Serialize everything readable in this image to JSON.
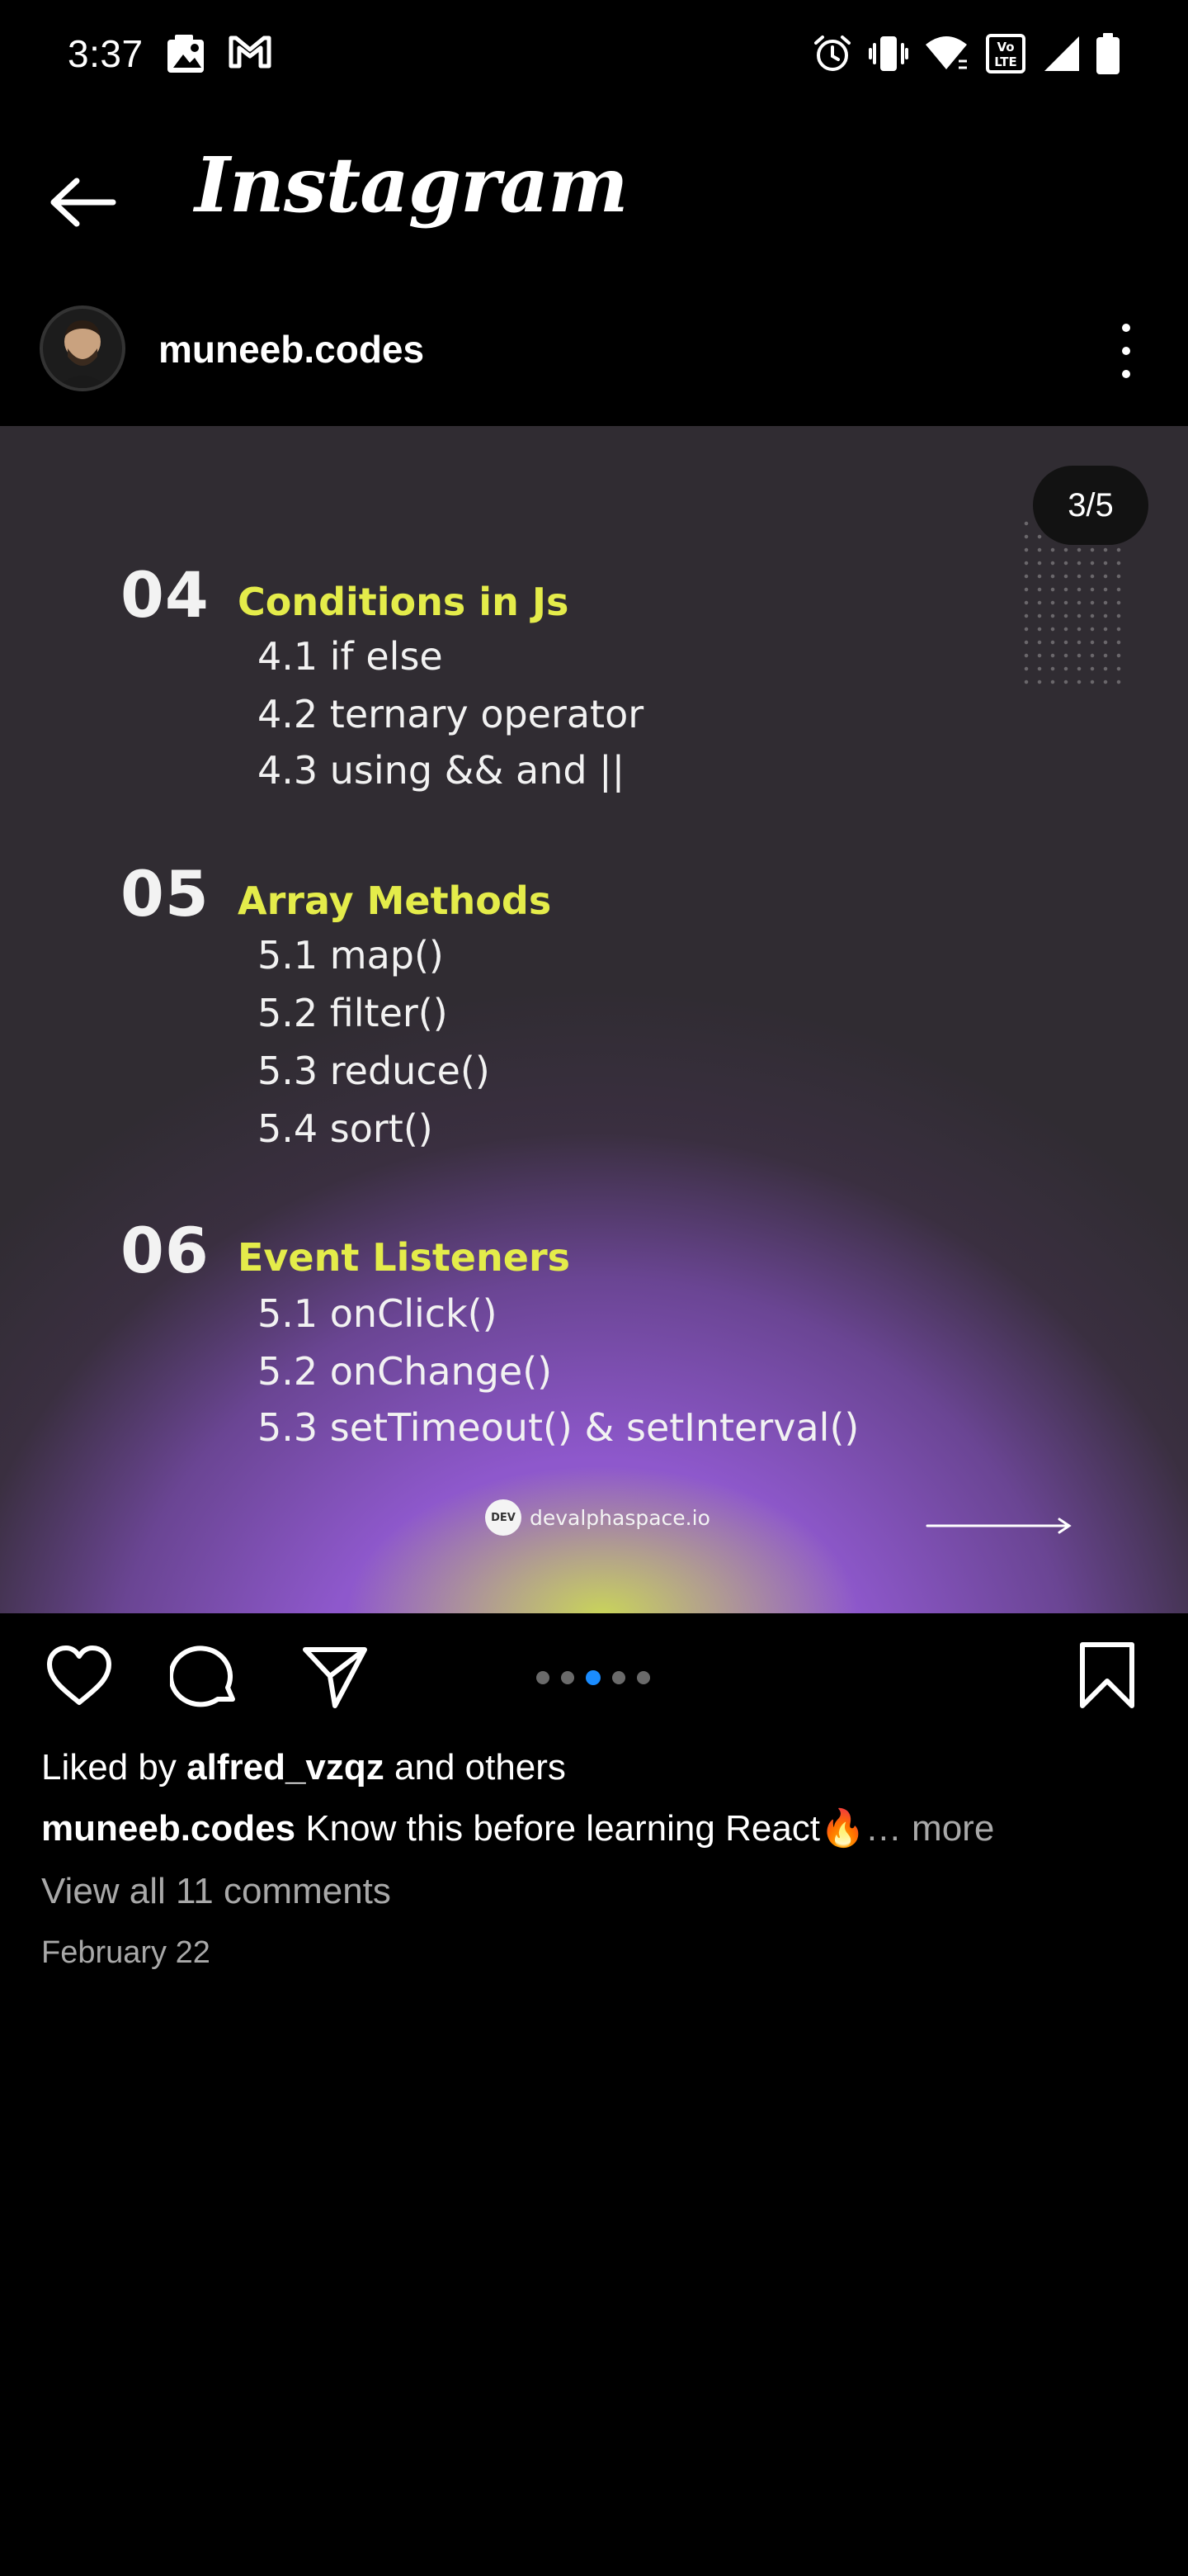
{
  "status_bar": {
    "time": "3:37"
  },
  "header": {
    "app_title": "Instagram"
  },
  "post": {
    "username": "muneeb.codes",
    "carousel": {
      "page_counter": "3/5",
      "total_slides": 5,
      "active_slide": 3,
      "sections": [
        {
          "number": "04",
          "title": "Conditions in Js",
          "items": [
            "4.1 if else",
            "4.2 ternary operator",
            "4.3 using &&  and ||"
          ]
        },
        {
          "number": "05",
          "title": "Array Methods",
          "items": [
            "5.1 map()",
            "5.2 filter()",
            "5.3 reduce()",
            "5.4 sort()"
          ]
        },
        {
          "number": "06",
          "title": "Event Listeners",
          "items": [
            "5.1 onClick()",
            "5.2 onChange()",
            "5.3 setTimeout() & setInterval()"
          ]
        }
      ],
      "brand_logo_text": "DEV",
      "brand_text": "devalphaspace.io"
    },
    "likes": {
      "prefix": "Liked by",
      "user": "alfred_vzqz",
      "suffix": "and others"
    },
    "caption": {
      "username": "muneeb.codes",
      "text": "Know this before learning React🔥",
      "more": "… more"
    },
    "comments_link": "View all 11 comments",
    "date": "February 22"
  },
  "icons": {
    "status": [
      "gallery-icon",
      "gmail-icon",
      "alarm-icon",
      "vibrate-icon",
      "wifi-icon",
      "volte-icon",
      "signal-icon",
      "battery-icon"
    ],
    "actions": [
      "heart-icon",
      "comment-icon",
      "share-icon",
      "bookmark-icon"
    ]
  }
}
